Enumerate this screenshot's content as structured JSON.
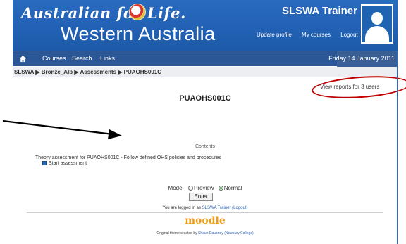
{
  "header": {
    "brand_line1": "Australian for Life.",
    "brand_line2": "Western Australia",
    "site_title": "SLSWA Trainer",
    "links": [
      "Update profile",
      "My courses",
      "Logout"
    ]
  },
  "nav": {
    "items": [
      "Courses",
      "Search",
      "Links"
    ],
    "date": "Friday 14 January 2011"
  },
  "breadcrumb": "SLSWA ▶ Bronze_Alb ▶ Assessments ▶ PUAOHS001C",
  "content": {
    "view_reports": "View reports for 3 users",
    "title": "PUAOHS001C",
    "contents_label": "Contents",
    "theory_text": "Theory assessment for PUAOHS001C - Follow defined OHS policies and procedures",
    "start_label": "Start assessment",
    "mode_label": "Mode:",
    "mode_options": [
      "Preview",
      "Normal"
    ],
    "mode_selected": "Normal",
    "enter_label": "Enter",
    "logged_in_prefix": "You are logged in as",
    "logged_in_user": "SLSWA Trainer",
    "logout_link": "(Logout)",
    "moodle_logo": "moodle",
    "theme_prefix": "Original theme created by",
    "theme_author": "Shaun Daubney (Newbury College)"
  },
  "colors": {
    "header_blue": "#2160b3",
    "nav_blue": "#2b5797",
    "annotation_red": "#c00000",
    "moodle_orange": "#f39c12"
  },
  "icons": [
    "home-icon",
    "seal-icon",
    "avatar-icon",
    "start-assessment-icon",
    "annotation-arrow"
  ]
}
